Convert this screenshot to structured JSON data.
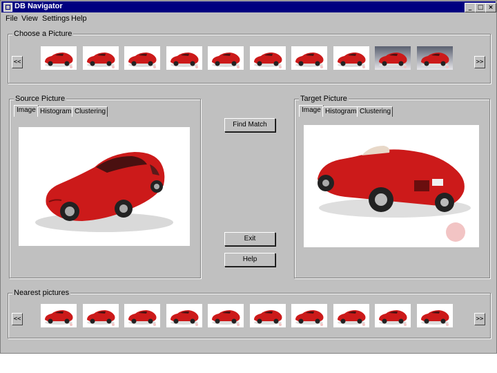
{
  "window": {
    "title": "DB Navigator"
  },
  "menu": [
    {
      "label": "File"
    },
    {
      "label": "View"
    },
    {
      "label": "Settings"
    },
    {
      "label": "Help"
    }
  ],
  "choose": {
    "label": "Choose a Picture",
    "prev_label": "<<",
    "next_label": ">>"
  },
  "source": {
    "label": "Source Picture",
    "tabs": [
      {
        "label": "Image"
      },
      {
        "label": "Histogram"
      },
      {
        "label": "Clustering"
      }
    ]
  },
  "target": {
    "label": "Target Picture",
    "tabs": [
      {
        "label": "Image"
      },
      {
        "label": "Histogram"
      },
      {
        "label": "Clustering"
      }
    ]
  },
  "buttons": {
    "find_match": "Find Match",
    "exit": "Exit",
    "help": "Help"
  },
  "nearest": {
    "label": "Nearest pictures",
    "prev_label": "<<",
    "next_label": ">>"
  },
  "colors": {
    "car_red": "#cc1a1a",
    "titlebar": "#000080",
    "face": "#c0c0c0"
  }
}
